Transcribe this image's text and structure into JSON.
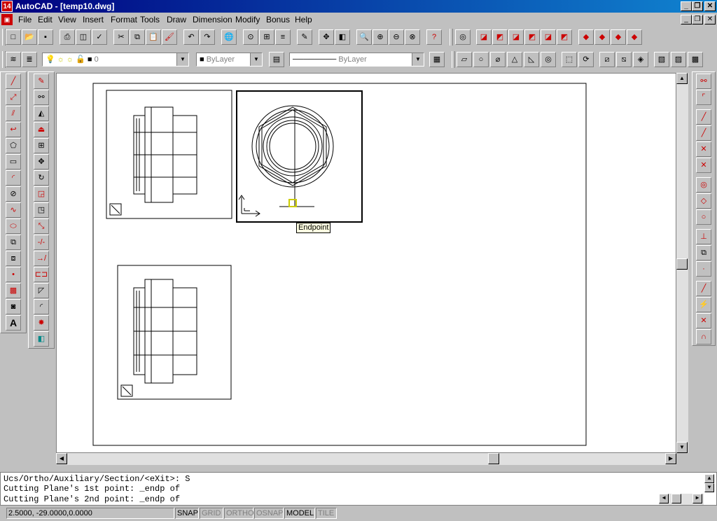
{
  "window": {
    "title": "AutoCAD - [temp10.dwg]",
    "app_icon_text": "14",
    "caption_buttons": [
      "_",
      "❐",
      "✕"
    ]
  },
  "menu": {
    "items": [
      "File",
      "Edit",
      "View",
      "Insert",
      "Format",
      "Tools",
      "Draw",
      "Dimension",
      "Modify",
      "Bonus",
      "Help"
    ]
  },
  "toolbar": {
    "layer_name": "0",
    "color_value": "ByLayer",
    "linetype_value": "ByLayer"
  },
  "canvas": {
    "tooltip": "Endpoint"
  },
  "command": {
    "lines": [
      "Ucs/Ortho/Auxiliary/Section/<eXit>: S",
      "Cutting Plane's 1st point: _endp of",
      "Cutting Plane's 2nd point: _endp of"
    ]
  },
  "status": {
    "coords": "2.5000, -29.0000,0.0000",
    "snap": "SNAP",
    "grid": "GRID",
    "ortho": "ORTHO",
    "osnap": "OSNAP",
    "model": "MODEL",
    "tile": "TILE"
  }
}
